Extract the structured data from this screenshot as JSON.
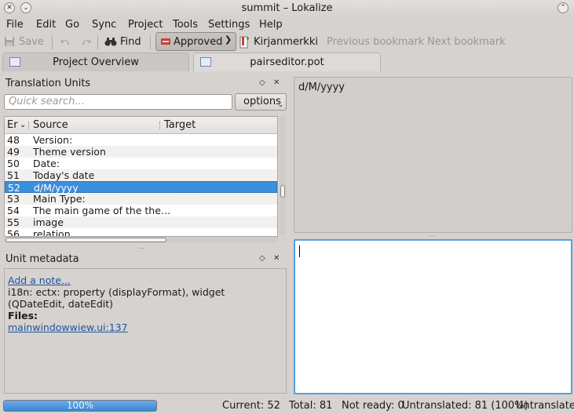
{
  "window": {
    "title": "summit – Lokalize"
  },
  "menu": [
    "File",
    "Edit",
    "Go",
    "Sync",
    "Project",
    "Tools",
    "Settings",
    "Help"
  ],
  "toolbar": {
    "save": "Save",
    "find": "Find",
    "approved": "Approved",
    "bookmarks": "Kirjanmerkki",
    "prev_bookmark": "Previous bookmark",
    "next_bookmark": "Next bookmark"
  },
  "tabs": [
    {
      "label": "Project Overview"
    },
    {
      "label": "pairseditor.pot"
    }
  ],
  "translation_units": {
    "title": "Translation Units",
    "search_placeholder": "Quick search...",
    "options": "options",
    "columns": {
      "entry": "Er",
      "source": "Source",
      "target": "Target"
    },
    "rows": [
      {
        "num": "48",
        "source": "Version:"
      },
      {
        "num": "49",
        "source": "Theme version"
      },
      {
        "num": "50",
        "source": "Date:"
      },
      {
        "num": "51",
        "source": "Today's date"
      },
      {
        "num": "52",
        "source": "d/M/yyyy"
      },
      {
        "num": "53",
        "source": "Main Type:"
      },
      {
        "num": "54",
        "source": "The main game of the the…"
      },
      {
        "num": "55",
        "source": "image"
      },
      {
        "num": "56",
        "source": "relation"
      }
    ],
    "selected_row": "52"
  },
  "unit_metadata": {
    "title": "Unit metadata",
    "add_note": "Add a note...",
    "context": "i18n: ectx: property (displayFormat), widget (QDateEdit, dateEdit)",
    "files_label": "Files:",
    "file_link": "mainwindowwiew.ui:137"
  },
  "editor": {
    "source_text": "d/M/yyyy",
    "target_text": ""
  },
  "status": {
    "progress_label": "100%",
    "progress_fraction": 1.0,
    "current": "Current: 52",
    "total": "Total: 81",
    "not_ready": "Not ready: 0",
    "untranslated": "Untranslated: 81 (100%)",
    "untranslated_cut": "Untranslated"
  }
}
